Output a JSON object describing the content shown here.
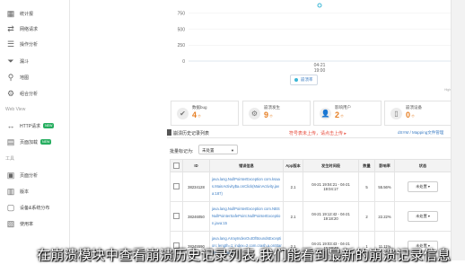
{
  "sidebar": {
    "items": [
      {
        "label": "统计报",
        "icon": "table-icon"
      },
      {
        "label": "网络请求",
        "icon": "transfer-icon"
      },
      {
        "label": "操作分析",
        "icon": "list-icon"
      },
      {
        "label": "漏斗",
        "icon": "funnel-icon"
      },
      {
        "label": "地图",
        "icon": "map-pin-icon"
      },
      {
        "label": "组合分析",
        "icon": "combo-icon"
      }
    ],
    "section_web": "Web View",
    "web_items": [
      {
        "label": "HTTP请求",
        "icon": "http-icon",
        "badge": "NEW"
      },
      {
        "label": "页面加载",
        "icon": "page-load-icon",
        "badge": "NEW"
      }
    ],
    "section_tools": "工具",
    "tool_items": [
      {
        "label": "页面分析",
        "icon": "page-analysis-icon"
      },
      {
        "label": "版本",
        "icon": "version-icon"
      },
      {
        "label": "设备&系统分布",
        "icon": "device-icon"
      },
      {
        "label": "使用率",
        "icon": "usage-icon"
      }
    ]
  },
  "chart": {
    "legend": "崩溃率",
    "credit": "Highcharts"
  },
  "chart_data": {
    "type": "line",
    "x": [
      "04-21 19:00"
    ],
    "series": [
      {
        "values": [
          1000
        ]
      }
    ],
    "yticks": [
      0,
      250,
      500,
      750
    ],
    "ylim": [
      0,
      1000
    ]
  },
  "stats": [
    {
      "label": "数据bug",
      "value": "4",
      "unit": "个",
      "icon": "thumbs-up-icon"
    },
    {
      "label": "崩溃发生",
      "value": "9",
      "unit": "个",
      "icon": "gear-icon"
    },
    {
      "label": "影响用户",
      "value": "2",
      "unit": "个",
      "icon": "user-icon"
    },
    {
      "label": "崩溃设备",
      "value": "0",
      "unit": "个",
      "icon": "device-icon"
    }
  ],
  "panel": {
    "title": "崩溃历史记录列表",
    "note": "符号表未上传，请点击上传 ▸",
    "link": "dSYM / Mapping文件管理",
    "filter_label": "批量标记为:",
    "filter_value": "未处置"
  },
  "table": {
    "headers": [
      "",
      "ID",
      "错误信息",
      "App版本",
      "发生时间段",
      "数量",
      "影响率",
      "状态"
    ],
    "rows": [
      {
        "id": "38234128",
        "error": "java.lang.NullPointerException com.ksaas.MainActivity$a.onClick(MainActivity.java:187)",
        "version": "2.1",
        "time": "04-21 19:04:21 - 04-21 19:04:17",
        "count": "5",
        "rate": "55.56%",
        "status": "未处置"
      },
      {
        "id": "38246050",
        "error": "java.lang.NullPointerException com.NBSNullPointerSafePoint.NullPointerException.java:15",
        "version": "2.1",
        "time": "04-21 19:12:42 - 04-21 19:18:20",
        "count": "2",
        "rate": "22.22%",
        "status": "未处置"
      },
      {
        "id": "38245590",
        "error": "java.lang.ArrayIndexOutOfBoundsException: length=1; index=2 com.crash.a.onStartActivity.java",
        "version": "2.1",
        "time": "04-21 19:03:43 - 04-21 19:03:43",
        "count": "1",
        "rate": "11.11%",
        "status": "未处置"
      }
    ]
  },
  "subtitle": "在崩溃模块中查看崩溃历史记录列表,我们能看到最新的崩溃记录信息"
}
